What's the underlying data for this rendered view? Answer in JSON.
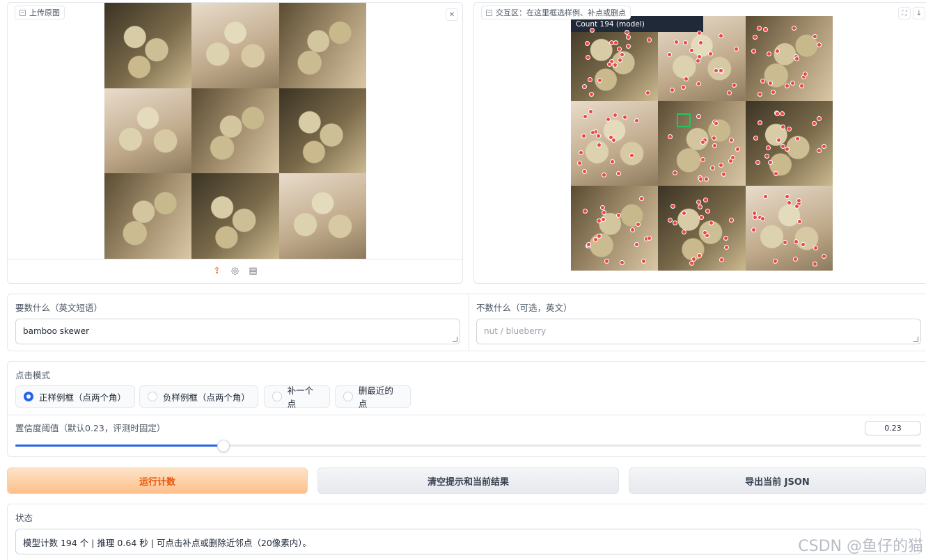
{
  "upload_panel": {
    "label": "上传原图",
    "close_icon": "close-icon",
    "toolbar_icons": [
      "upload-icon",
      "webcam-icon",
      "clipboard-icon"
    ]
  },
  "interact_panel": {
    "label": "交互区：在这里框选样例、补点或删点",
    "overlay_label": "Count 194 (model)",
    "toolbar_icons": [
      "fullscreen-icon",
      "download-icon"
    ]
  },
  "prompt": {
    "count_label": "要数什么（英文短语）",
    "count_value": "bamboo skewer",
    "exclude_label": "不数什么（可选，英文）",
    "exclude_placeholder": "nut / blueberry"
  },
  "click_mode": {
    "label": "点击模式",
    "options": [
      "正样例框（点两个角）",
      "负样例框（点两个角）",
      "补一个点",
      "删最近的点"
    ],
    "selected": "正样例框（点两个角）"
  },
  "threshold": {
    "label": "置信度阈值（默认0.23，评测时固定）",
    "value": "0.23",
    "fraction": 0.23
  },
  "buttons": {
    "run": "运行计数",
    "clear": "清空提示和当前结果",
    "export": "导出当前 JSON"
  },
  "status": {
    "label": "状态",
    "text": "模型计数 194 个 | 推理 0.64 秒 | 可点击补点或删除近邻点（20像素内）。"
  },
  "watermark": "CSDN @鱼仔的猫",
  "colors": {
    "accent": "#2563eb",
    "run_text": "#ea580c",
    "point": "#ef4444",
    "exemplar_box": "#22c55e"
  }
}
